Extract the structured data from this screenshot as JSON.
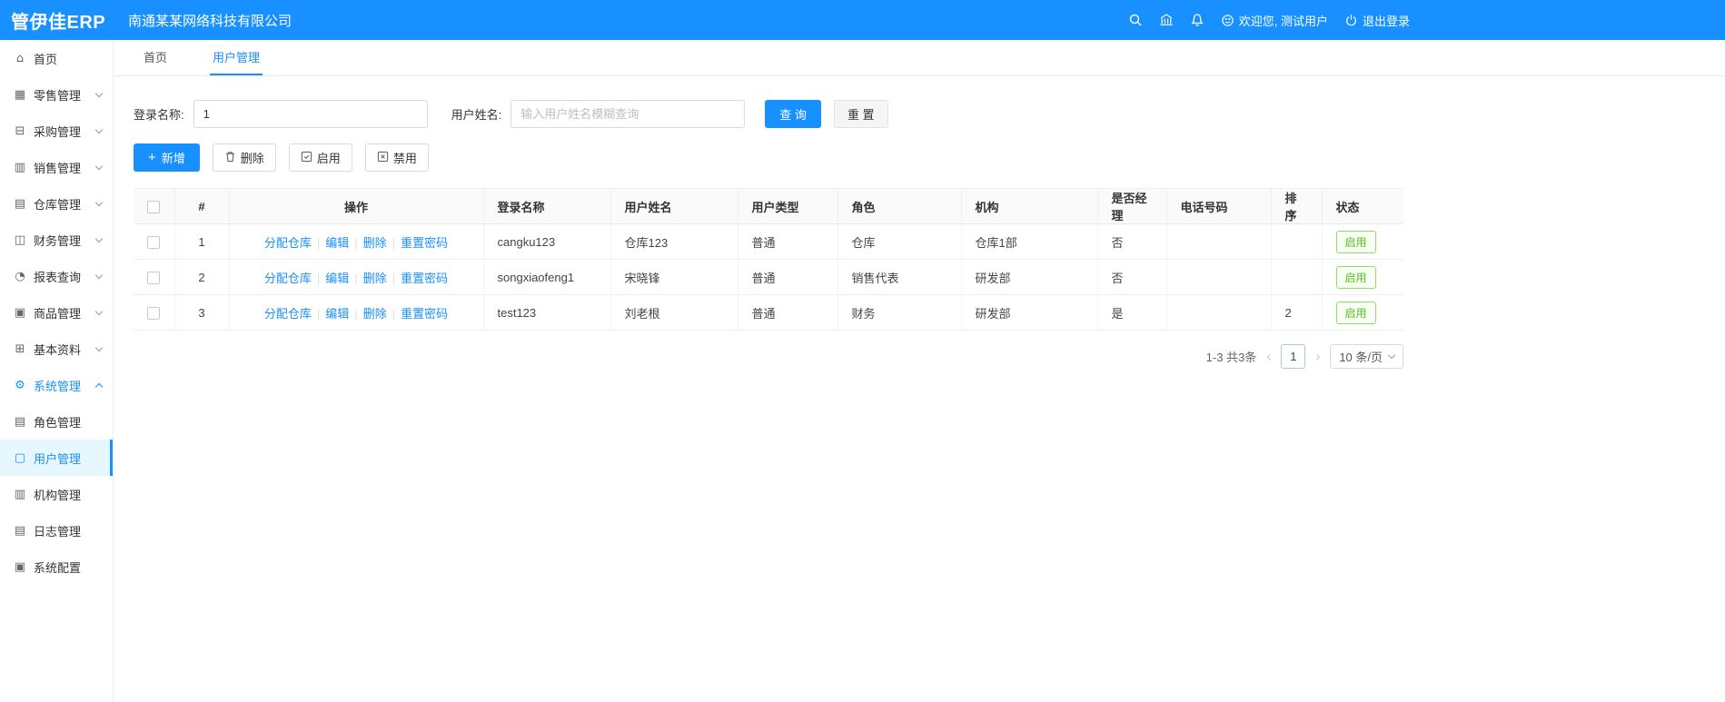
{
  "topbar": {
    "logo": "管伊佳ERP",
    "company": "南通某某网络科技有限公司",
    "welcome": "欢迎您, 测试用户",
    "logout": "退出登录"
  },
  "tabs": {
    "home": "首页",
    "current": "用户管理"
  },
  "sidebar": {
    "items": [
      {
        "label": "首页",
        "glyph": "⌂"
      },
      {
        "label": "零售管理",
        "glyph": "▦"
      },
      {
        "label": "采购管理",
        "glyph": "⊟"
      },
      {
        "label": "销售管理",
        "glyph": "▥"
      },
      {
        "label": "仓库管理",
        "glyph": "▤"
      },
      {
        "label": "财务管理",
        "glyph": "◫"
      },
      {
        "label": "报表查询",
        "glyph": "◔"
      },
      {
        "label": "商品管理",
        "glyph": "▣"
      },
      {
        "label": "基本资料",
        "glyph": "⊞"
      },
      {
        "label": "系统管理",
        "glyph": "⚙"
      }
    ],
    "subitems": [
      {
        "label": "角色管理",
        "glyph": "▤"
      },
      {
        "label": "用户管理",
        "glyph": "▢"
      },
      {
        "label": "机构管理",
        "glyph": "▥"
      },
      {
        "label": "日志管理",
        "glyph": "▤"
      },
      {
        "label": "系统配置",
        "glyph": "▣"
      }
    ]
  },
  "search": {
    "login_label": "登录名称:",
    "login_value": "1",
    "name_label": "用户姓名:",
    "name_placeholder": "输入用户姓名模糊查询",
    "query_button": "查 询",
    "reset_button": "重 置"
  },
  "toolbar": {
    "add": "新增",
    "delete": "删除",
    "enable": "启用",
    "disable": "禁用"
  },
  "table": {
    "headers": [
      "#",
      "操作",
      "登录名称",
      "用户姓名",
      "用户类型",
      "角色",
      "机构",
      "是否经理",
      "电话号码",
      "排序",
      "状态"
    ],
    "action_links": [
      "分配仓库",
      "编辑",
      "删除",
      "重置密码"
    ],
    "rows": [
      {
        "index": "1",
        "login": "cangku123",
        "name": "仓库123",
        "type": "普通",
        "role": "仓库",
        "org": "仓库1部",
        "manager": "否",
        "phone": "",
        "sort": "",
        "status": "启用"
      },
      {
        "index": "2",
        "login": "songxiaofeng1",
        "name": "宋晓锋",
        "type": "普通",
        "role": "销售代表",
        "org": "研发部",
        "manager": "否",
        "phone": "",
        "sort": "",
        "status": "启用"
      },
      {
        "index": "3",
        "login": "test123",
        "name": "刘老根",
        "type": "普通",
        "role": "财务",
        "org": "研发部",
        "manager": "是",
        "phone": "",
        "sort": "2",
        "status": "启用"
      }
    ]
  },
  "pagination": {
    "total": "1-3 共3条",
    "prev": "‹",
    "page": "1",
    "next": "›",
    "page_size": "10 条/页"
  },
  "colors": {
    "primary": "#1890ff",
    "success": "#52c41a"
  }
}
